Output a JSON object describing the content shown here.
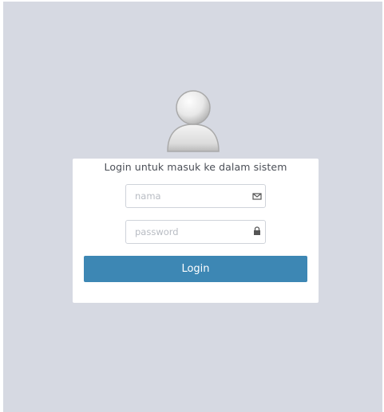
{
  "login": {
    "title": "Login untuk masuk ke dalam sistem",
    "username": {
      "value": "",
      "placeholder": "nama",
      "icon": "envelope-icon"
    },
    "password": {
      "value": "",
      "placeholder": "password",
      "icon": "lock-icon"
    },
    "submit_label": "Login"
  },
  "avatar": {
    "icon": "user-avatar-icon"
  },
  "colors": {
    "background": "#d6d9e2",
    "card": "#ffffff",
    "button": "#3d87b4",
    "button_text": "#ffffff"
  }
}
